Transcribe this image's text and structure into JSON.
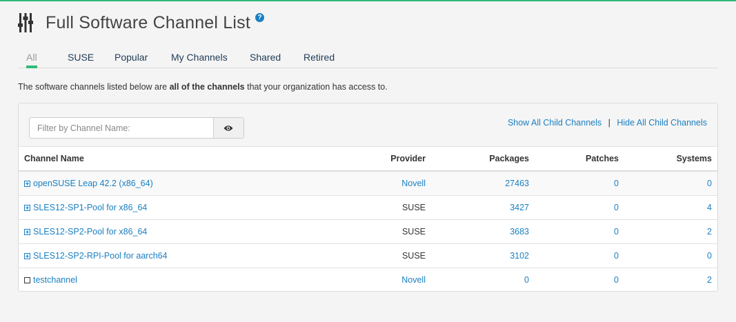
{
  "page": {
    "title": "Full Software Channel List",
    "help_glyph": "?",
    "description_prefix": "The software channels listed below are ",
    "description_bold": "all of the channels",
    "description_suffix": " that your organization has access to."
  },
  "tabs": [
    {
      "label": "All",
      "active": true
    },
    {
      "label": "SUSE"
    },
    {
      "label": "Popular"
    },
    {
      "label": "My Channels"
    },
    {
      "label": "Shared"
    },
    {
      "label": "Retired"
    }
  ],
  "filter": {
    "placeholder": "Filter by Channel Name:"
  },
  "child_links": {
    "show": "Show All Child Channels",
    "separator": "|",
    "hide": "Hide All Child Channels"
  },
  "table": {
    "headers": {
      "name": "Channel Name",
      "provider": "Provider",
      "packages": "Packages",
      "patches": "Patches",
      "systems": "Systems"
    },
    "rows": [
      {
        "name": "openSUSE Leap 42.2 (x86_64)",
        "provider": "Novell",
        "packages": "27463",
        "patches": "0",
        "systems": "0",
        "has_children": true
      },
      {
        "name": "SLES12-SP1-Pool for x86_64",
        "provider": "SUSE",
        "packages": "3427",
        "patches": "0",
        "systems": "4",
        "has_children": true
      },
      {
        "name": "SLES12-SP2-Pool for x86_64",
        "provider": "SUSE",
        "packages": "3683",
        "patches": "0",
        "systems": "2",
        "has_children": true
      },
      {
        "name": "SLES12-SP2-RPI-Pool for aarch64",
        "provider": "SUSE",
        "packages": "3102",
        "patches": "0",
        "systems": "0",
        "has_children": true
      },
      {
        "name": "testchannel",
        "provider": "Novell",
        "packages": "0",
        "patches": "0",
        "systems": "2",
        "has_children": false
      }
    ]
  },
  "colors": {
    "accent": "#30ba78",
    "link": "#1a7fc1"
  }
}
